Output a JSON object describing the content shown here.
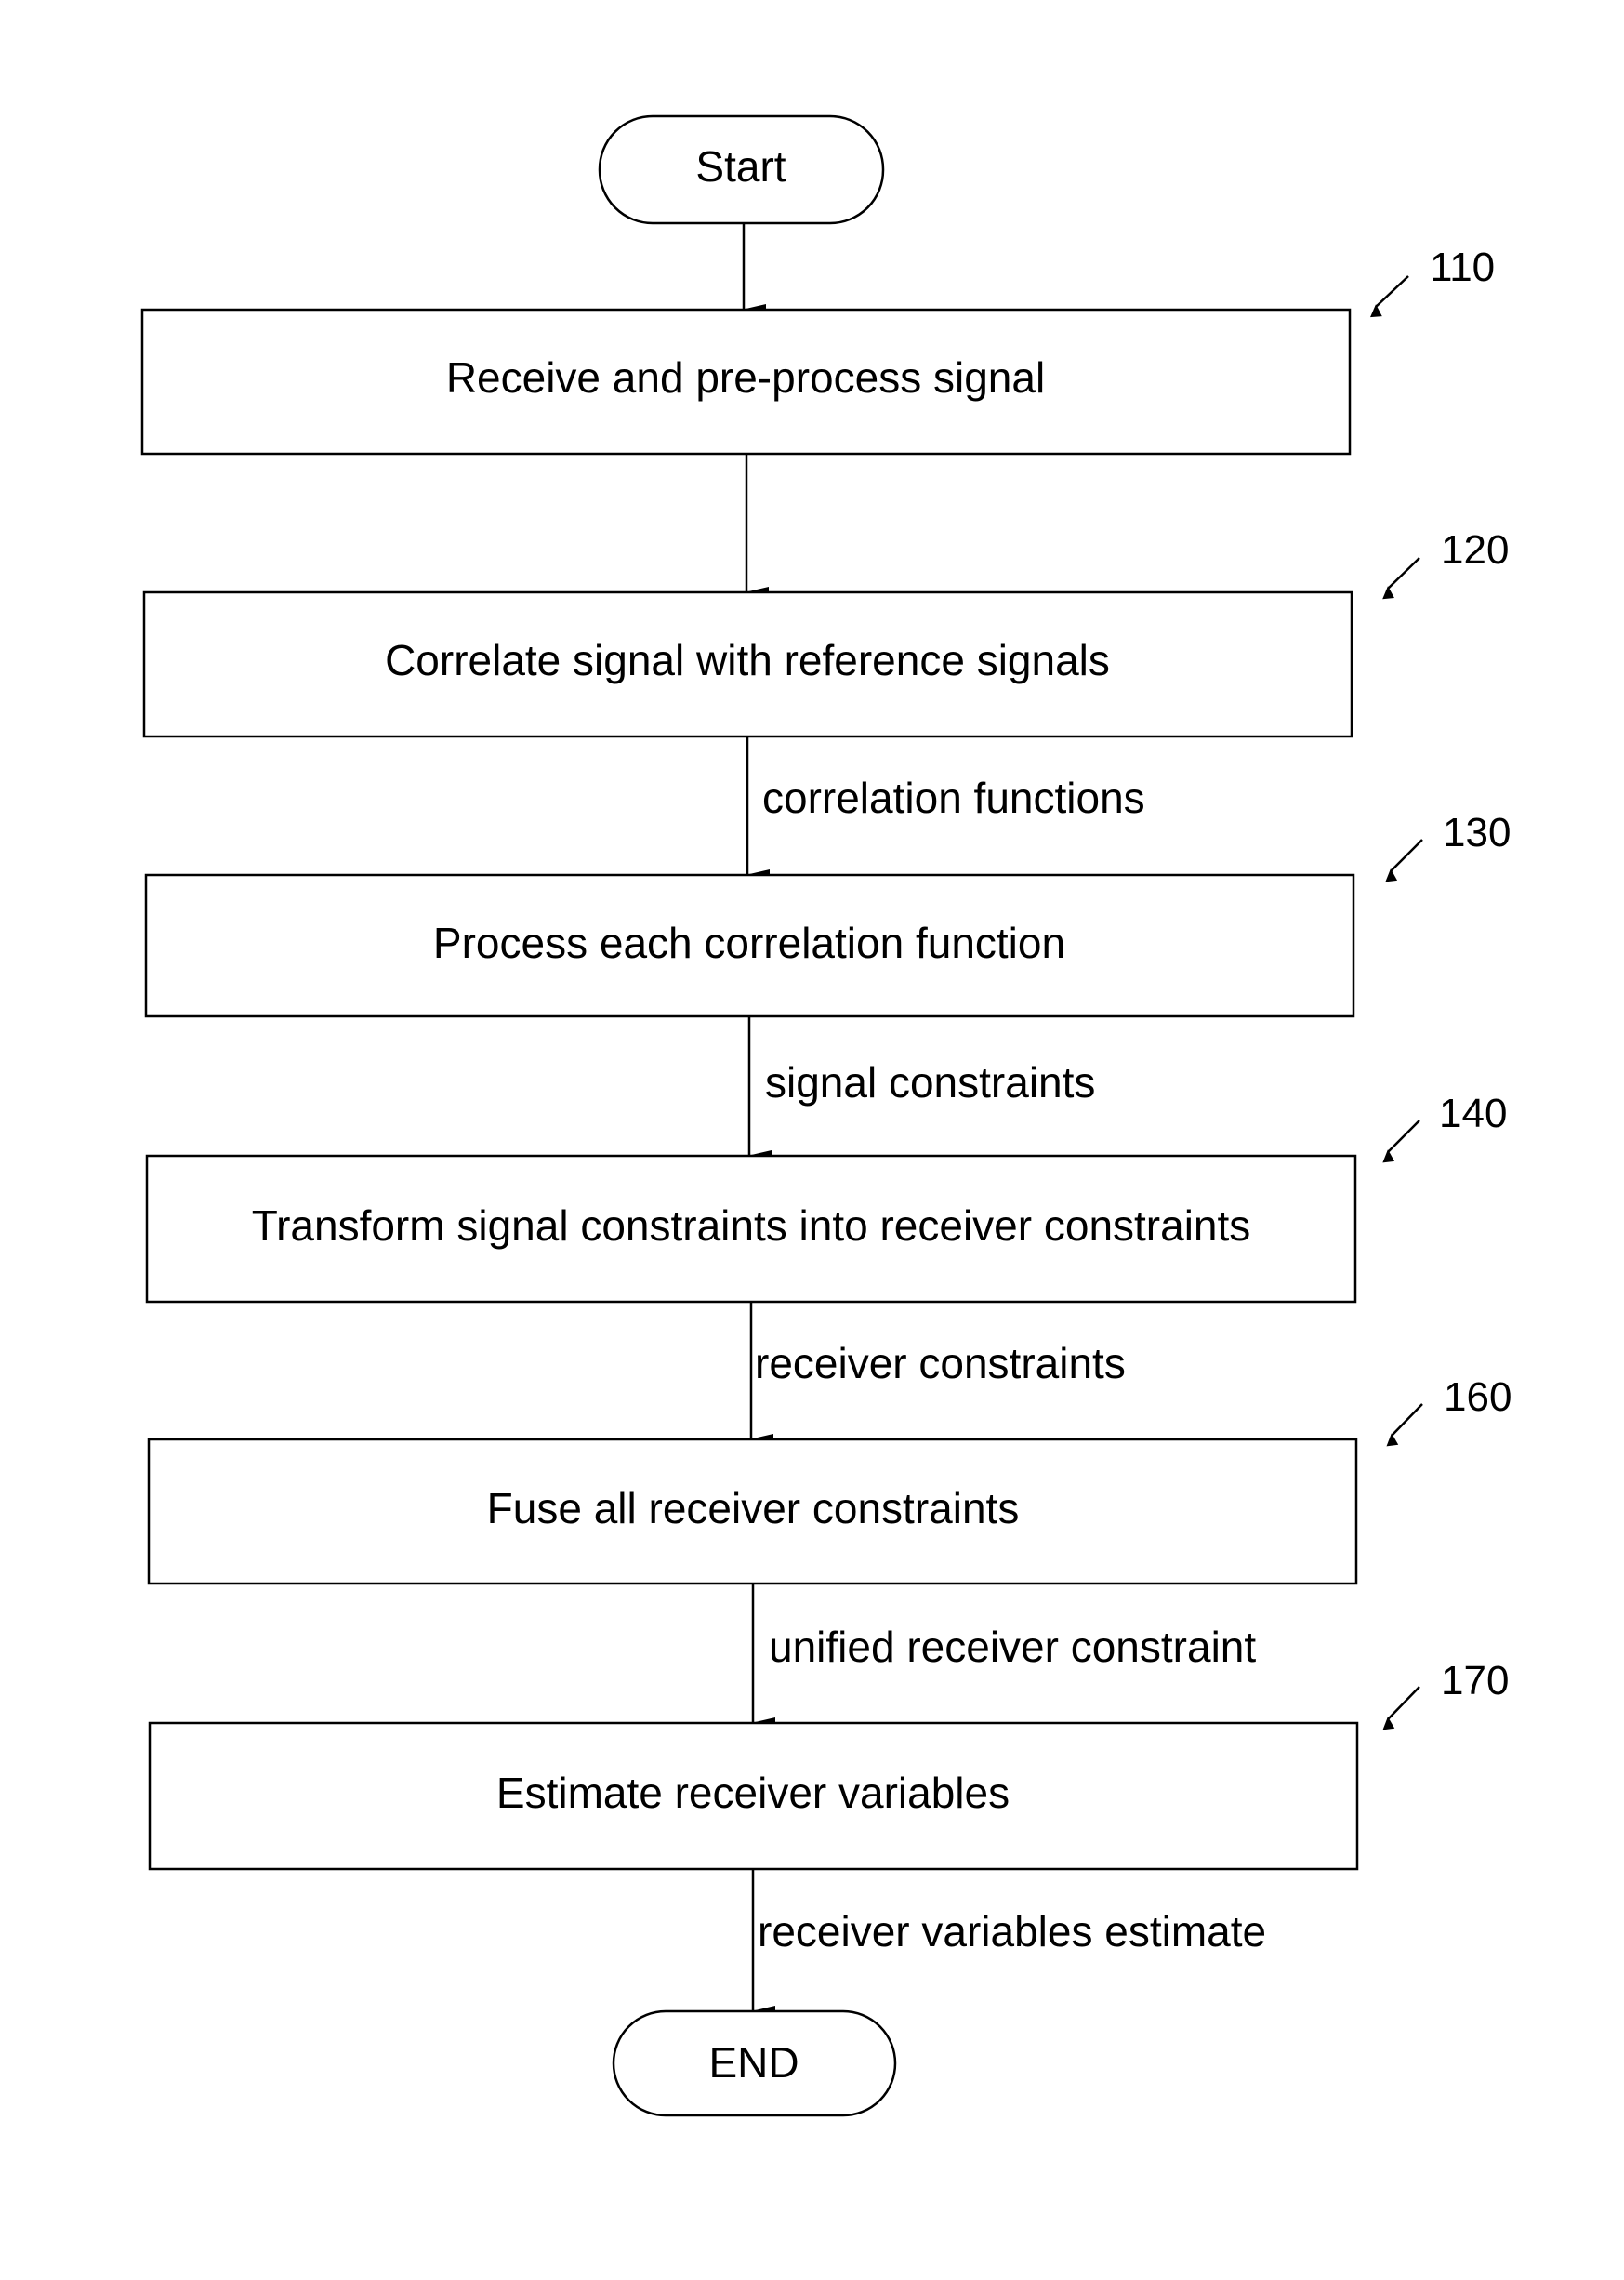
{
  "figure": {
    "start_label": "Start",
    "end_label": "END",
    "steps": [
      {
        "ref": "110",
        "label": "Receive and pre-process signal",
        "output": ""
      },
      {
        "ref": "120",
        "label": "Correlate signal with reference signals",
        "output": "correlation functions"
      },
      {
        "ref": "130",
        "label": "Process each correlation function",
        "output": "signal constraints"
      },
      {
        "ref": "140",
        "label": "Transform signal constraints into receiver constraints",
        "output": "receiver constraints"
      },
      {
        "ref": "160",
        "label": "Fuse all receiver constraints",
        "output": "unified receiver constraint"
      },
      {
        "ref": "170",
        "label": "Estimate receiver variables",
        "output": "receiver variables estimate"
      }
    ]
  }
}
